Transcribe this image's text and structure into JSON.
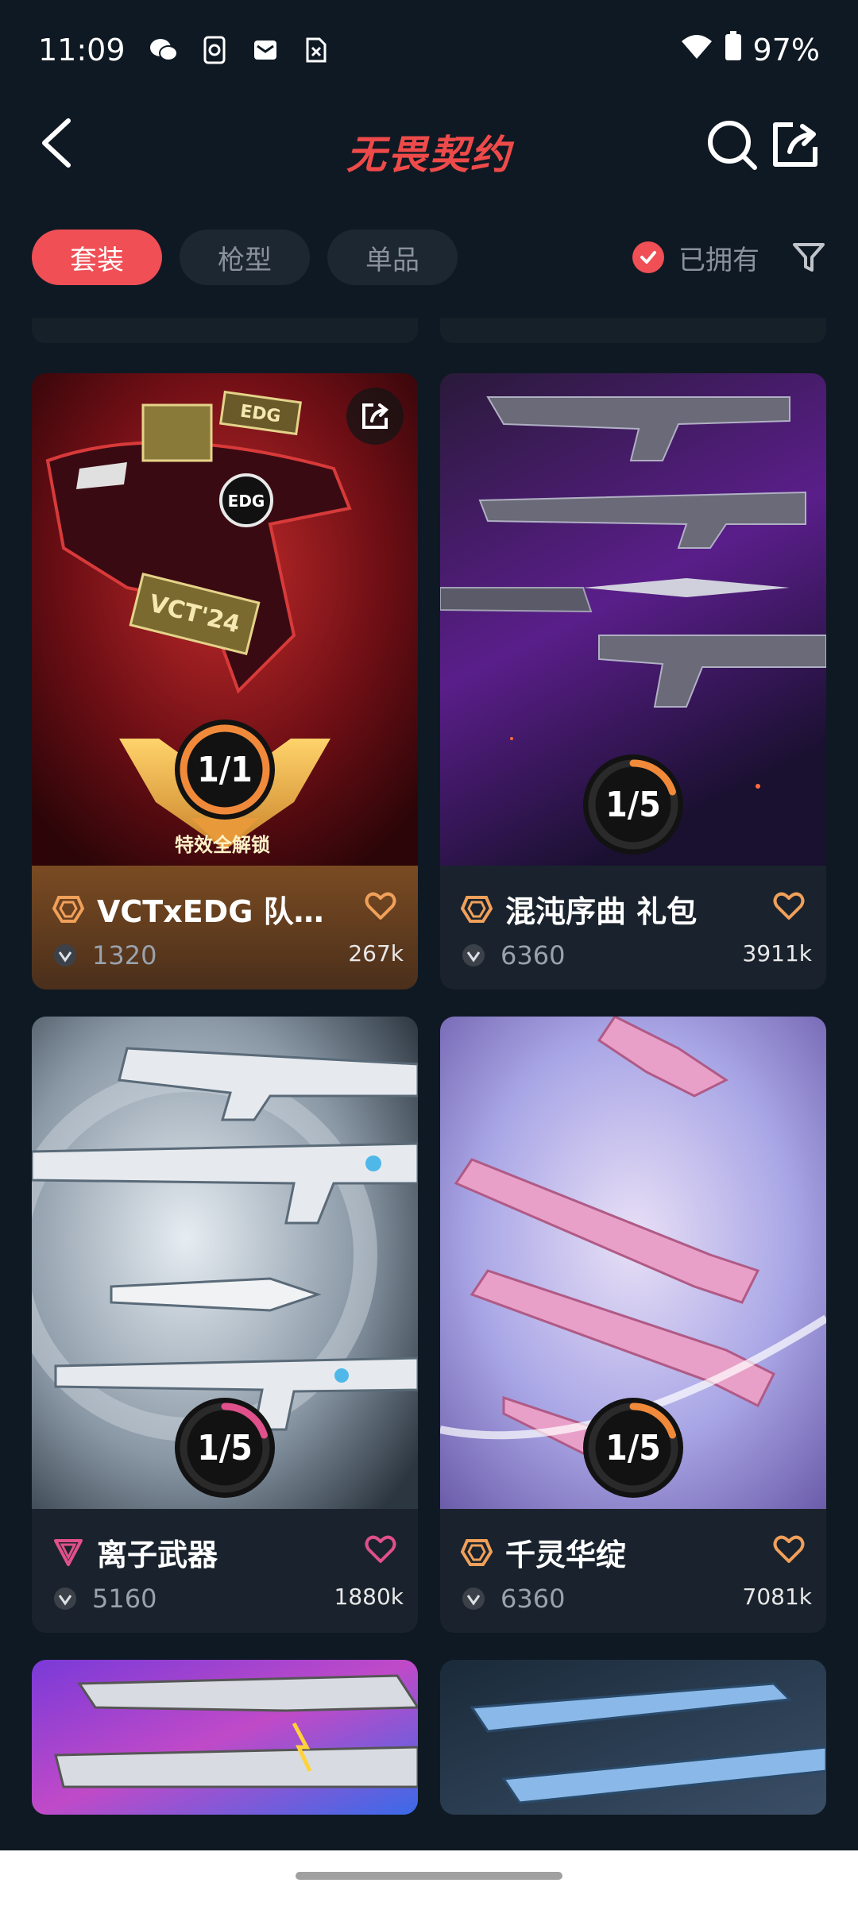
{
  "status_bar": {
    "time": "11:09",
    "battery": "97%",
    "notification_icons": [
      "wechat-icon",
      "phone-sync-icon",
      "mail-icon",
      "file-icon"
    ]
  },
  "header": {
    "title": "无畏契约",
    "accent_color": "#ef4a4a"
  },
  "filters": {
    "tabs": [
      {
        "label": "套装",
        "active": true
      },
      {
        "label": "枪型",
        "active": false
      },
      {
        "label": "单品",
        "active": false
      }
    ],
    "owned_label": "已拥有",
    "owned_checked": true
  },
  "cards": [
    {
      "name": "VCTxEDG 队伍...",
      "price": "1320",
      "likes": "267k",
      "progress": "1/1",
      "progress_fraction": 1.0,
      "unlock_text": "特效全解锁",
      "tier_color": "#f0a05a"
    },
    {
      "name": "混沌序曲 礼包",
      "price": "6360",
      "likes": "3911k",
      "progress": "1/5",
      "progress_fraction": 0.2,
      "tier_color": "#f0a05a"
    },
    {
      "name": "离子武器",
      "price": "5160",
      "likes": "1880k",
      "progress": "1/5",
      "progress_fraction": 0.2,
      "tier_color": "#e0508a"
    },
    {
      "name": "千灵华绽",
      "price": "6360",
      "likes": "7081k",
      "progress": "1/5",
      "progress_fraction": 0.2,
      "tier_color": "#f0a05a"
    }
  ]
}
